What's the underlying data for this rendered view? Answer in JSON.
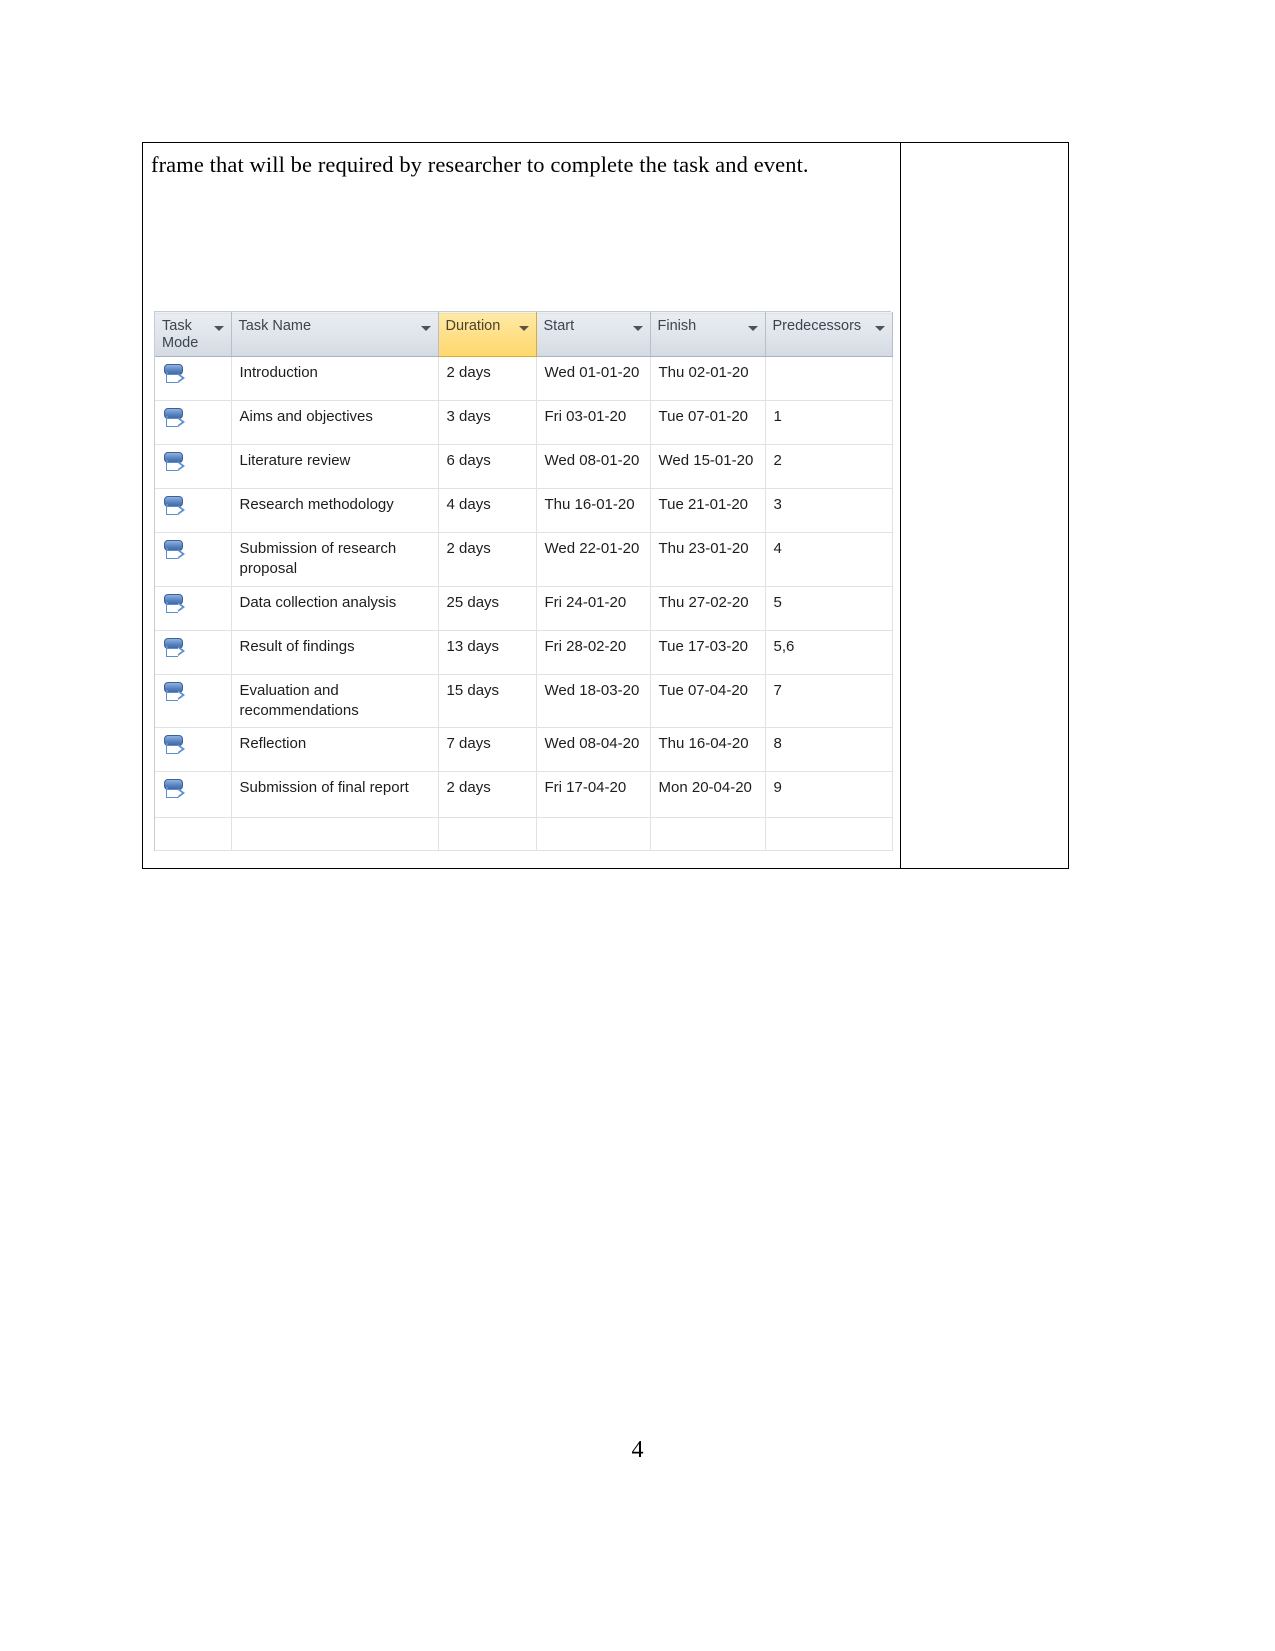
{
  "document": {
    "paragraph": "frame that will be required by researcher to complete the task and event.",
    "page_number": "4"
  },
  "project_table": {
    "columns": [
      {
        "key": "task_mode",
        "label": "Task Mode",
        "highlighted": false
      },
      {
        "key": "task_name",
        "label": "Task Name",
        "highlighted": false
      },
      {
        "key": "duration",
        "label": "Duration",
        "highlighted": true
      },
      {
        "key": "start",
        "label": "Start",
        "highlighted": false
      },
      {
        "key": "finish",
        "label": "Finish",
        "highlighted": false
      },
      {
        "key": "predecessors",
        "label": "Predecessors",
        "highlighted": false
      }
    ],
    "highlight_color": "#FFD86E",
    "header_color": "#DFE4EA",
    "task_mode_icon": "manually-scheduled-icon",
    "rows": [
      {
        "task_name": "Introduction",
        "duration": "2 days",
        "start": "Wed 01-01-20",
        "finish": "Thu 02-01-20",
        "predecessors": ""
      },
      {
        "task_name": "Aims and objectives",
        "duration": "3 days",
        "start": "Fri 03-01-20",
        "finish": "Tue 07-01-20",
        "predecessors": "1"
      },
      {
        "task_name": "Literature review",
        "duration": "6 days",
        "start": "Wed 08-01-20",
        "finish": "Wed 15-01-20",
        "predecessors": "2"
      },
      {
        "task_name": "Research methodology",
        "duration": "4 days",
        "start": "Thu 16-01-20",
        "finish": "Tue 21-01-20",
        "predecessors": "3"
      },
      {
        "task_name": "Submission of research proposal",
        "duration": "2 days",
        "start": "Wed 22-01-20",
        "finish": "Thu 23-01-20",
        "predecessors": "4"
      },
      {
        "task_name": "Data collection analysis",
        "duration": "25 days",
        "start": "Fri 24-01-20",
        "finish": "Thu 27-02-20",
        "predecessors": "5"
      },
      {
        "task_name": "Result of findings",
        "duration": "13 days",
        "start": "Fri 28-02-20",
        "finish": "Tue 17-03-20",
        "predecessors": "5,6"
      },
      {
        "task_name": "Evaluation and recommendations",
        "duration": "15 days",
        "start": "Wed 18-03-20",
        "finish": "Tue 07-04-20",
        "predecessors": "7"
      },
      {
        "task_name": "Reflection",
        "duration": "7 days",
        "start": "Wed 08-04-20",
        "finish": "Thu 16-04-20",
        "predecessors": "8"
      },
      {
        "task_name": "Submission of final report",
        "duration": "2 days",
        "start": "Fri 17-04-20",
        "finish": "Mon 20-04-20",
        "predecessors": "9"
      }
    ]
  }
}
